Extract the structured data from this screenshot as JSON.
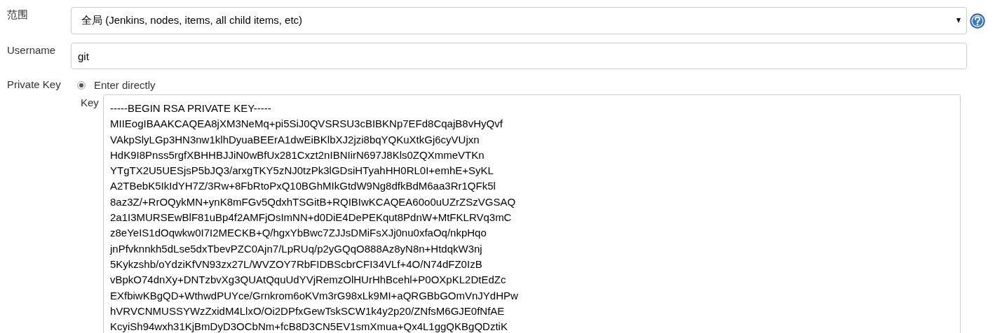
{
  "scope": {
    "label": "范围",
    "value": "全局 (Jenkins, nodes, items, all child items, etc)"
  },
  "username": {
    "label": "Username",
    "value": "git"
  },
  "private_key": {
    "label": "Private Key",
    "options": [
      {
        "label": "Enter directly",
        "selected": true
      }
    ],
    "key": {
      "label": "Key",
      "lines": [
        "-----BEGIN RSA PRIVATE KEY-----",
        "MIIEogIBAAKCAQEA8jXM3NeMq+pi5SiJ0QVSRSU3cBIBKNp7EFd8CqajB8vHyQvf",
        "VAkpSlyLGp3HN3nw1klhDyuaBEErA1dwEiBKlbXJ2jzi8bqYQKuXtkGj6cyVUjxn",
        "HdK9I8Pnss5rgfXBHHBJJiN0wBfUx281Cxzt2nIBNIirN697J8Kls0ZQXmmeVTKn",
        "YTgTX2U5UESjsP5bJQ3/arxgTKY5zNJ0tzPk3lGDsiHTyahHH0RL0I+emhE+SyKL",
        "A2TBebK5IkIdYH7Z/3Rw+8FbRtoPxQ10BGhMIkGtdW9Ng8dfkBdM6aa3Rr1QFk5l",
        "8az3Z/+RrOQykMN+ynK8mFGv5QdxhTSGitB+RQIBIwKCAQEA60o0uUZrZSzVGSAQ",
        "2a1I3MURSEwBlF81uBp4f2AMFjOsImNN+d0DiE4DePEKqut8PdnW+MtFKLRVq3mC",
        "z8eYeIS1dOqwkw0I7I2MECKB+Q/hgxYbBwc7ZJJsDMiFsXJj0nu0xfaOq/nkpHqo",
        "jnPfvknnkh5dLse5dxTbevPZC0Ajn7/LpRUq/p2yGQqO888Az8yN8n+HtdqkW3nj",
        "5Kykzshb/oYdziKfVN93zx27L/WVZOY7RbFIDBScbrCFI34VLf+4O/N74dFZ0IzB",
        "vBpkO74dnXy+DNTzbvXg3QUAtQquUdYVjRemzOlHUrHhBcehl+P0OXpKL2DtEdZc",
        "EXfbiwKBgQD+WthwdPUYce/Grnkrom6oKVm3rG98xLk9MI+aQRGBbGOmVnJYdHPw",
        "hVRVCNMUSSYWzZxidM4LlxO/Oi2DPfxGewTskSCW1k4y2p20/ZNfsM6GJE0fNfAE",
        "KcyiSh94wxh31KjBmDyD3OCbNm+fcB8D3CN5EV1smXmua+Qx4L1ggQKBgQDztiK"
      ]
    }
  }
}
